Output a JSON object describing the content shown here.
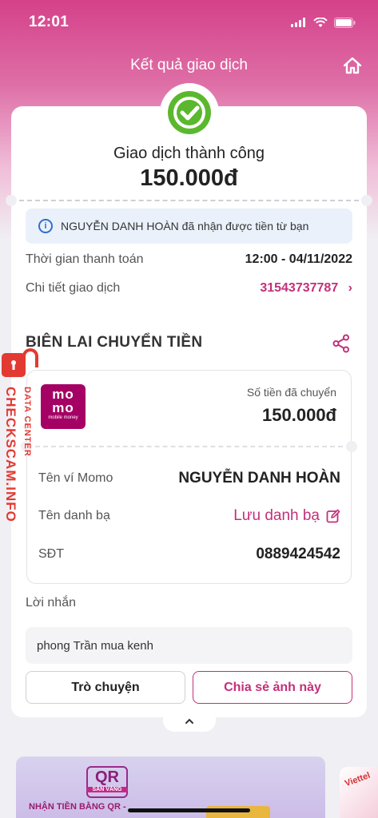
{
  "status_bar": {
    "time": "12:01"
  },
  "header": {
    "title": "Kết quả giao dịch",
    "home_icon": "home-icon"
  },
  "result": {
    "status": "Giao dịch thành công",
    "amount": "150.000đ",
    "status_icon": "check-circle-icon",
    "status_color": "#5bb82e"
  },
  "notice": {
    "text": "NGUYỄN DANH HOÀN đã nhận được tiền từ bạn"
  },
  "details": {
    "time_label": "Thời gian thanh toán",
    "time_value": "12:00 - 04/11/2022",
    "txn_label": "Chi tiết giao dịch",
    "txn_value": "31543737787",
    "txn_chevron": "›"
  },
  "receipt": {
    "title": "BIÊN LAI CHUYỂN TIỀN",
    "share_icon": "share-icon",
    "logo": {
      "line1": "mo",
      "line2": "mo",
      "line3": "mobile money"
    },
    "sent_label": "Số tiền đã chuyển",
    "sent_amount": "150.000đ",
    "wallet_label": "Tên ví Momo",
    "wallet_value": "NGUYỄN DANH HOÀN",
    "contact_label": "Tên danh bạ",
    "contact_value": "Lưu danh bạ",
    "phone_label": "SĐT",
    "phone_value": "0889424542"
  },
  "message": {
    "label": "Lời nhắn",
    "text": "phong Trần mua kenh"
  },
  "actions": {
    "chat_label": "Trò chuyện",
    "share_label": "Chia sẻ ảnh này"
  },
  "banner": {
    "qr_text": "QR",
    "qr_sub": "SĂN VÀNG",
    "text": "NHẬN TIỀN BẰNG QR -",
    "side_text": "Viettel"
  },
  "watermark": {
    "big": "CHECKSCAM.INFO",
    "small": "DATA CENTER"
  },
  "colors": {
    "brand": "#c2307a",
    "momo": "#a50064",
    "info": "#2f6fd1"
  }
}
